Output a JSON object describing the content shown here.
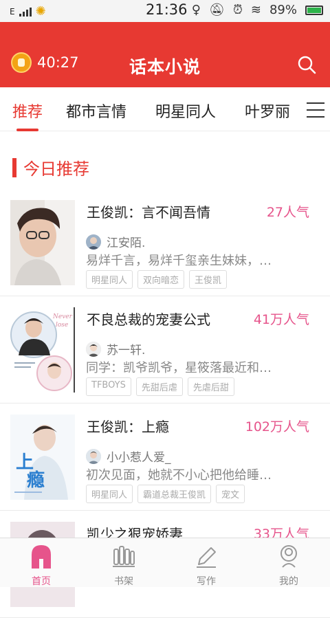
{
  "status_bar": {
    "network": "E",
    "time": "21:36",
    "battery": "89%"
  },
  "header": {
    "timer": "40:27",
    "title": "话本小说"
  },
  "tabs": [
    {
      "label": "推荐"
    },
    {
      "label": "都市言情"
    },
    {
      "label": "明星同人"
    },
    {
      "label": "叶罗丽"
    }
  ],
  "section": {
    "title": "今日推荐"
  },
  "books": [
    {
      "title": "王俊凯：言不闻吾情",
      "popularity": "27人气",
      "author": "江安陌.",
      "desc": "易烊千言，易烊千玺亲生妹妹，…",
      "tags": [
        "明星同人",
        "双向暗恋",
        "王俊凯"
      ]
    },
    {
      "title": "不良总裁的宠妻公式",
      "popularity": "41万人气",
      "author": "苏一轩.",
      "desc": "同学：凯爷凯爷，星筱落最近和…",
      "tags": [
        "TFBOYS",
        "先甜后虐",
        "先虐后甜"
      ]
    },
    {
      "title": "王俊凯：上瘾",
      "popularity": "102万人气",
      "author": "小小惹人爱_",
      "desc": "初次见面，她就不小心把他给睡…",
      "tags": [
        "明星同人",
        "霸道总裁王俊凯",
        "宠文"
      ]
    },
    {
      "title": "凯少之狠宠娇妻",
      "popularity": "33万人气"
    }
  ],
  "bottom_nav": [
    {
      "label": "首页"
    },
    {
      "label": "书架"
    },
    {
      "label": "写作"
    },
    {
      "label": "我的"
    }
  ]
}
